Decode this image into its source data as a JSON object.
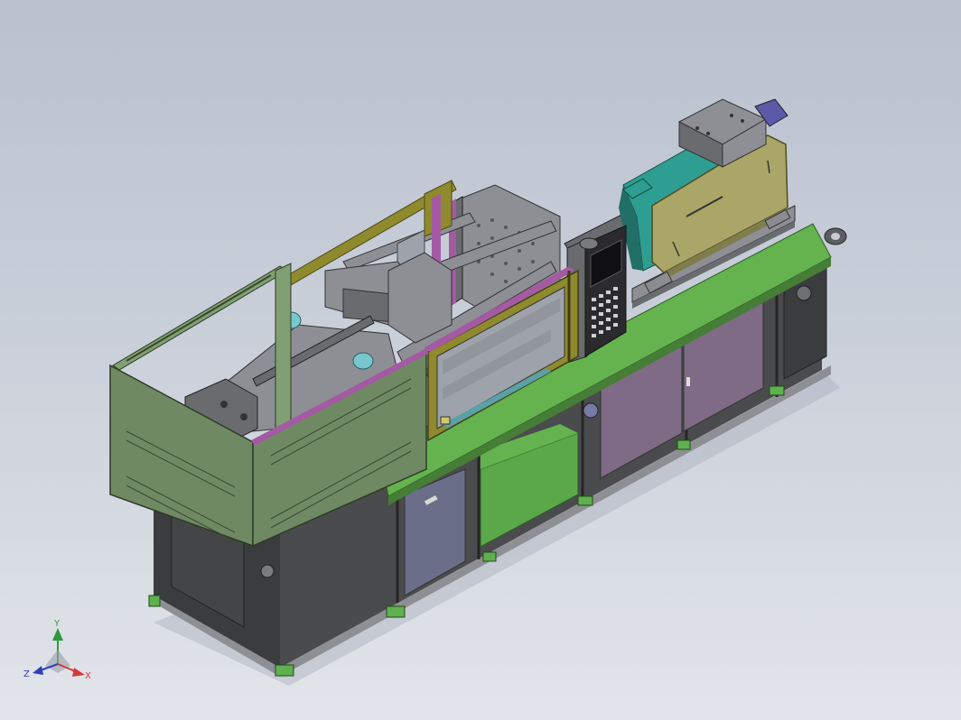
{
  "viewport": {
    "background_top": "#b9c1cf",
    "background_bottom": "#e2e5ea"
  },
  "model": {
    "colors": {
      "guard_green": "#6f8a63",
      "base_dark": "#4a4b4d",
      "deck_green": "#64b34e",
      "door_purple": "#7f6b86",
      "door_slate": "#6b6e88",
      "frame_yellow": "#8f8a2e",
      "injection_teal": "#2f9e92",
      "housing_khaki": "#a9a667",
      "steel_gray": "#8d8f94",
      "accent_magenta": "#a35aa3",
      "controller_black": "#2b2b2e",
      "nozzle_cyan": "#7ac6cf",
      "inner_green": "#5aa84a",
      "window_gray": "#9ea3ab"
    }
  },
  "triad": {
    "y_label": "Y",
    "x_label": "X",
    "z_label": "Z",
    "y_color": "#2f9a3a",
    "x_color": "#d23b3b",
    "z_color": "#2f3fb8"
  }
}
